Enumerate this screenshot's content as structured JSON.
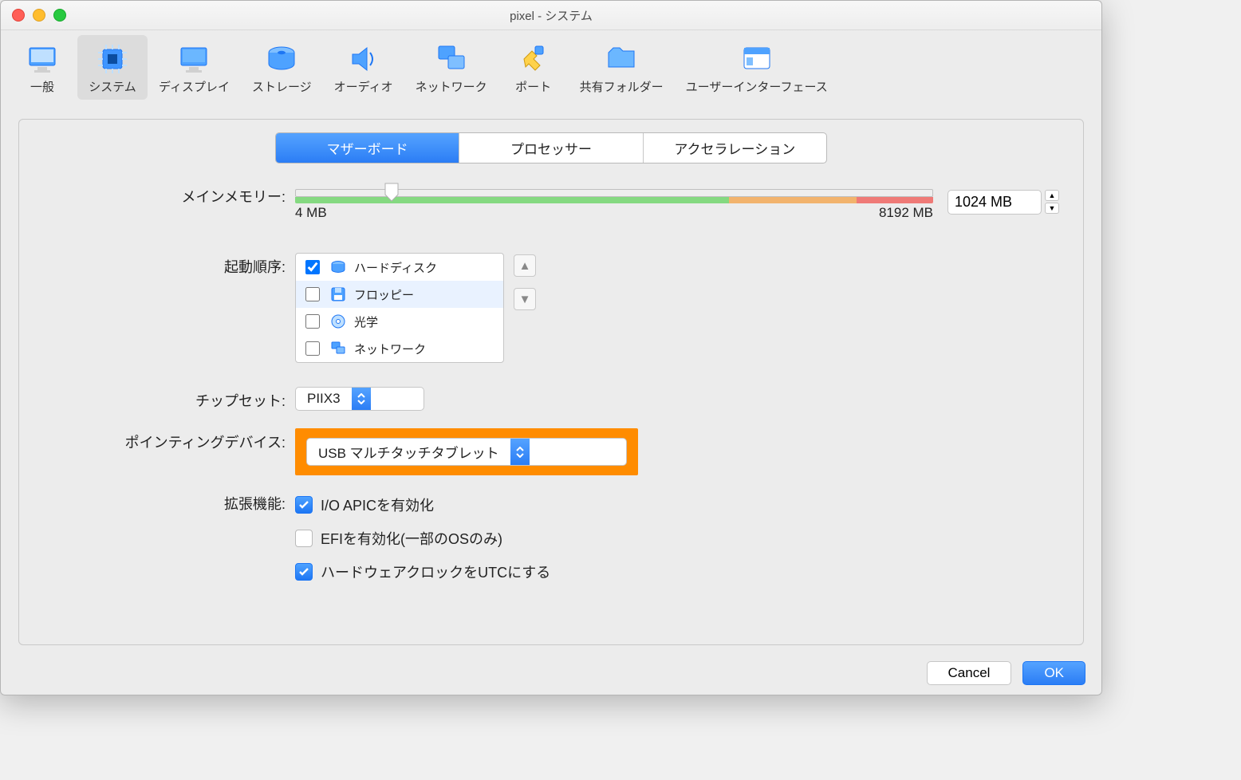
{
  "window": {
    "title": "pixel - システム"
  },
  "toolbar": {
    "items": [
      {
        "label": "一般"
      },
      {
        "label": "システム"
      },
      {
        "label": "ディスプレイ"
      },
      {
        "label": "ストレージ"
      },
      {
        "label": "オーディオ"
      },
      {
        "label": "ネットワーク"
      },
      {
        "label": "ポート"
      },
      {
        "label": "共有フォルダー"
      },
      {
        "label": "ユーザーインターフェース"
      }
    ]
  },
  "tabs": {
    "motherboard": "マザーボード",
    "processor": "プロセッサー",
    "acceleration": "アクセラレーション"
  },
  "labels": {
    "main_memory": "メインメモリー:",
    "boot_order": "起動順序:",
    "chipset": "チップセット:",
    "pointing_device": "ポインティングデバイス:",
    "extended_features": "拡張機能:"
  },
  "memory": {
    "value": "1024 MB",
    "min_label": "4 MB",
    "max_label": "8192 MB"
  },
  "boot": {
    "items": [
      {
        "label": "ハードディスク",
        "checked": true
      },
      {
        "label": "フロッピー",
        "checked": false
      },
      {
        "label": "光学",
        "checked": false
      },
      {
        "label": "ネットワーク",
        "checked": false
      }
    ]
  },
  "chipset": {
    "value": "PIIX3"
  },
  "pointing_device": {
    "value": "USB マルチタッチタブレット"
  },
  "features": {
    "io_apic": "I/O APICを有効化",
    "efi": "EFIを有効化(一部のOSのみ)",
    "utc_clock": "ハードウェアクロックをUTCにする"
  },
  "buttons": {
    "cancel": "Cancel",
    "ok": "OK"
  }
}
